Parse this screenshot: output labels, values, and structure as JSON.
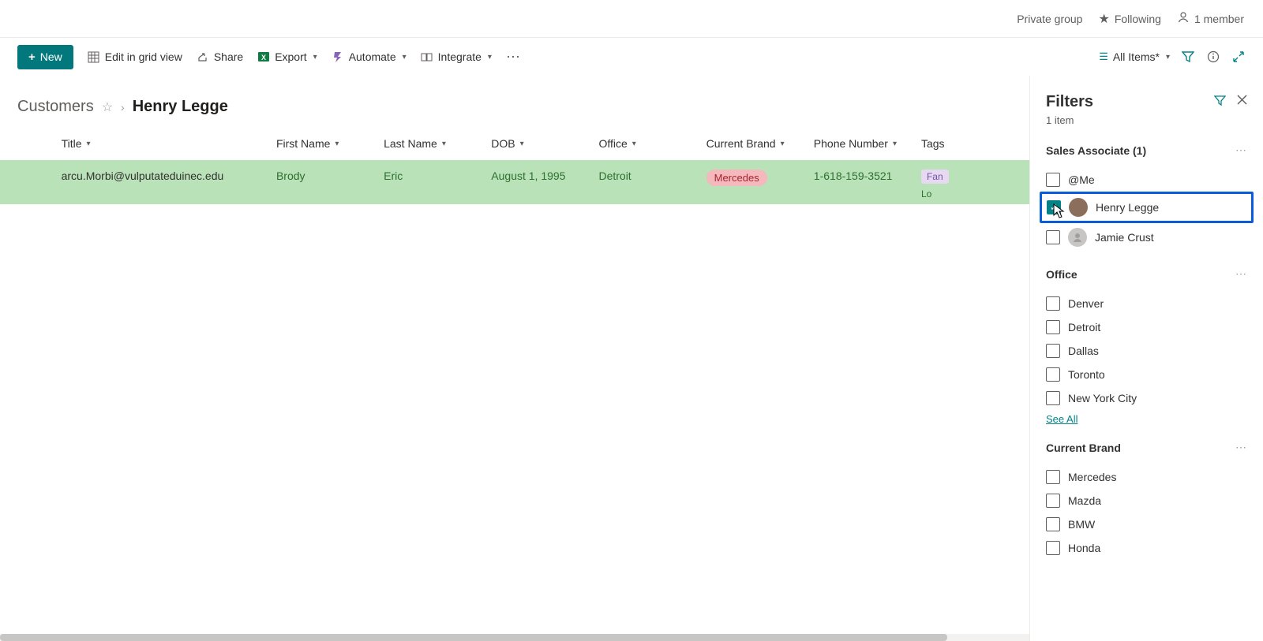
{
  "header": {
    "private_group": "Private group",
    "following": "Following",
    "member": "1 member"
  },
  "toolbar": {
    "new_label": "New",
    "edit_grid": "Edit in grid view",
    "share": "Share",
    "export": "Export",
    "automate": "Automate",
    "integrate": "Integrate",
    "view_label": "All Items*"
  },
  "breadcrumb": {
    "root": "Customers",
    "current": "Henry Legge"
  },
  "columns": {
    "title": "Title",
    "first_name": "First Name",
    "last_name": "Last Name",
    "dob": "DOB",
    "office": "Office",
    "brand": "Current Brand",
    "phone": "Phone Number",
    "tags": "Tags"
  },
  "rows": [
    {
      "title": "arcu.Morbi@vulputateduinec.edu",
      "first_name": "Brody",
      "last_name": "Eric",
      "dob": "August 1, 1995",
      "office": "Detroit",
      "brand": "Mercedes",
      "phone": "1-618-159-3521",
      "tag1": "Fan",
      "tag2": "Lo"
    }
  ],
  "filters": {
    "title": "Filters",
    "count": "1 item",
    "groups": {
      "sales_associate": {
        "title": "Sales Associate (1)",
        "options": {
          "me": "@Me",
          "henry": "Henry Legge",
          "jamie": "Jamie Crust"
        }
      },
      "office": {
        "title": "Office",
        "options": {
          "denver": "Denver",
          "detroit": "Detroit",
          "dallas": "Dallas",
          "toronto": "Toronto",
          "nyc": "New York City"
        },
        "see_all": "See All"
      },
      "brand": {
        "title": "Current Brand",
        "options": {
          "mercedes": "Mercedes",
          "mazda": "Mazda",
          "bmw": "BMW",
          "honda": "Honda"
        }
      }
    }
  }
}
